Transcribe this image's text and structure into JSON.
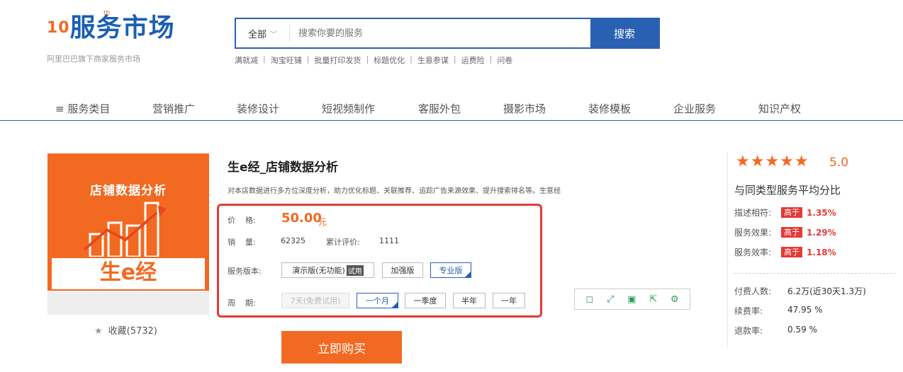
{
  "logo": {
    "anniversary": "10",
    "superscript": "th",
    "name": "服务市场",
    "subtitle": "阿里巴巴旗下商家服务市场"
  },
  "search": {
    "scope": "全部",
    "placeholder": "搜索你要的服务",
    "button": "搜索",
    "hot_links": [
      "满就减",
      "淘宝旺铺",
      "批量打印发货",
      "标题优化",
      "生意参谋",
      "运费险",
      "问卷"
    ]
  },
  "nav": {
    "items": [
      "≡ 服务类目",
      "营销推广",
      "装修设计",
      "短视频制作",
      "客服外包",
      "摄影市场",
      "装修模板",
      "企业服务",
      "知识产权"
    ]
  },
  "product": {
    "image_title": "店铺数据分析",
    "image_brand": "生e经",
    "favorite": "收藏(5732)",
    "title": "生e经_店铺数据分析",
    "description": "对本店数据进行多方位深度分析，助力优化标题、关联推荐、追踪广告来源效果、提升搜索排名等。生意经",
    "price_label": "价    格:",
    "price": "50.00",
    "price_unit": "元",
    "sales_label": "销    量:",
    "sales": "62325",
    "reviews_label": "累计评价:",
    "reviews": "1111",
    "version_label": "服务版本:",
    "versions": [
      {
        "label": "演示版(无功能)",
        "badge": "试用"
      },
      {
        "label": "加强版"
      },
      {
        "label": "专业版"
      }
    ],
    "period_label": "周    期:",
    "periods": [
      "7天(免费试用)",
      "一个月",
      "一季度",
      "半年",
      "一年"
    ],
    "buy_button": "立即购买"
  },
  "rating": {
    "stars": "★★★★★",
    "score": "5.0",
    "compare_title": "与同类型服务平均分比",
    "rows": [
      {
        "label": "描述相符:",
        "tag": "高于",
        "value": "1.35%"
      },
      {
        "label": "服务效果:",
        "tag": "高于",
        "value": "1.29%"
      },
      {
        "label": "服务效率:",
        "tag": "高于",
        "value": "1.18%"
      }
    ],
    "stats": [
      {
        "label": "付费人数:",
        "value": "6.2万(近30天1.3万)"
      },
      {
        "label": "续费率:",
        "value": "47.95 %"
      },
      {
        "label": "退款率:",
        "value": "0.59 %"
      }
    ]
  },
  "colors": {
    "brand_blue": "#2a60b3",
    "accent_orange": "#f26a21",
    "highlight_red": "#e53935"
  }
}
